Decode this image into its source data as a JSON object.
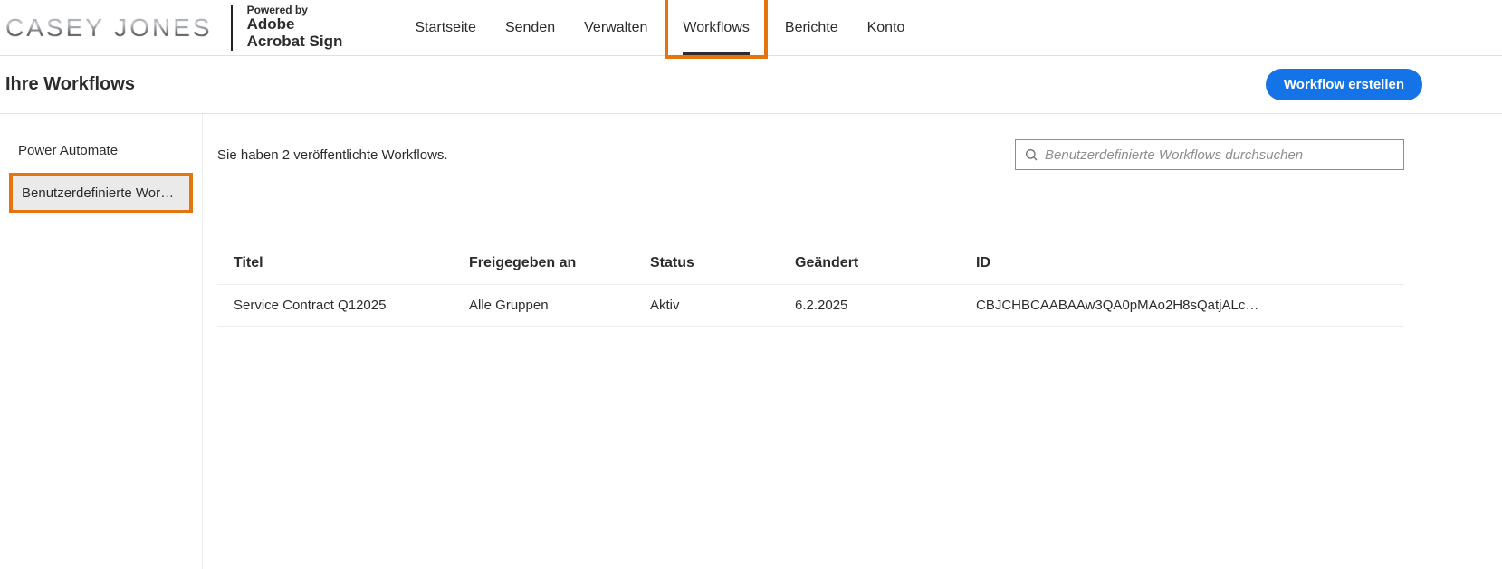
{
  "header": {
    "logo_text": "CASEY JONES",
    "powered_by_label": "Powered by",
    "brand_line1": "Adobe",
    "brand_line2": "Acrobat Sign",
    "nav": {
      "home": {
        "label": "Startseite"
      },
      "send": {
        "label": "Senden"
      },
      "manage": {
        "label": "Verwalten"
      },
      "workflows": {
        "label": "Workflows"
      },
      "reports": {
        "label": "Berichte"
      },
      "account": {
        "label": "Konto"
      }
    }
  },
  "page": {
    "title": "Ihre Workflows",
    "create_button_label": "Workflow erstellen"
  },
  "sidebar": {
    "items": [
      {
        "label": "Power Automate"
      },
      {
        "label": "Benutzerdefinierte Workfl…"
      }
    ]
  },
  "content": {
    "published_count_text": "Sie haben 2 veröffentlichte Workflows.",
    "search_placeholder": "Benutzerdefinierte Workflows durchsuchen"
  },
  "table": {
    "columns": {
      "title": "Titel",
      "shared": "Freigegeben an",
      "status": "Status",
      "modified": "Geändert",
      "id": "ID"
    },
    "rows": [
      {
        "title": "Service Contract Q12025",
        "shared": "Alle Gruppen",
        "status": "Aktiv",
        "modified": "6.2.2025",
        "id": "CBJCHBCAABAAw3QA0pMAo2H8sQatjALc…"
      }
    ]
  },
  "colors": {
    "accent": "#1473e6",
    "highlight": "#e2750f"
  }
}
